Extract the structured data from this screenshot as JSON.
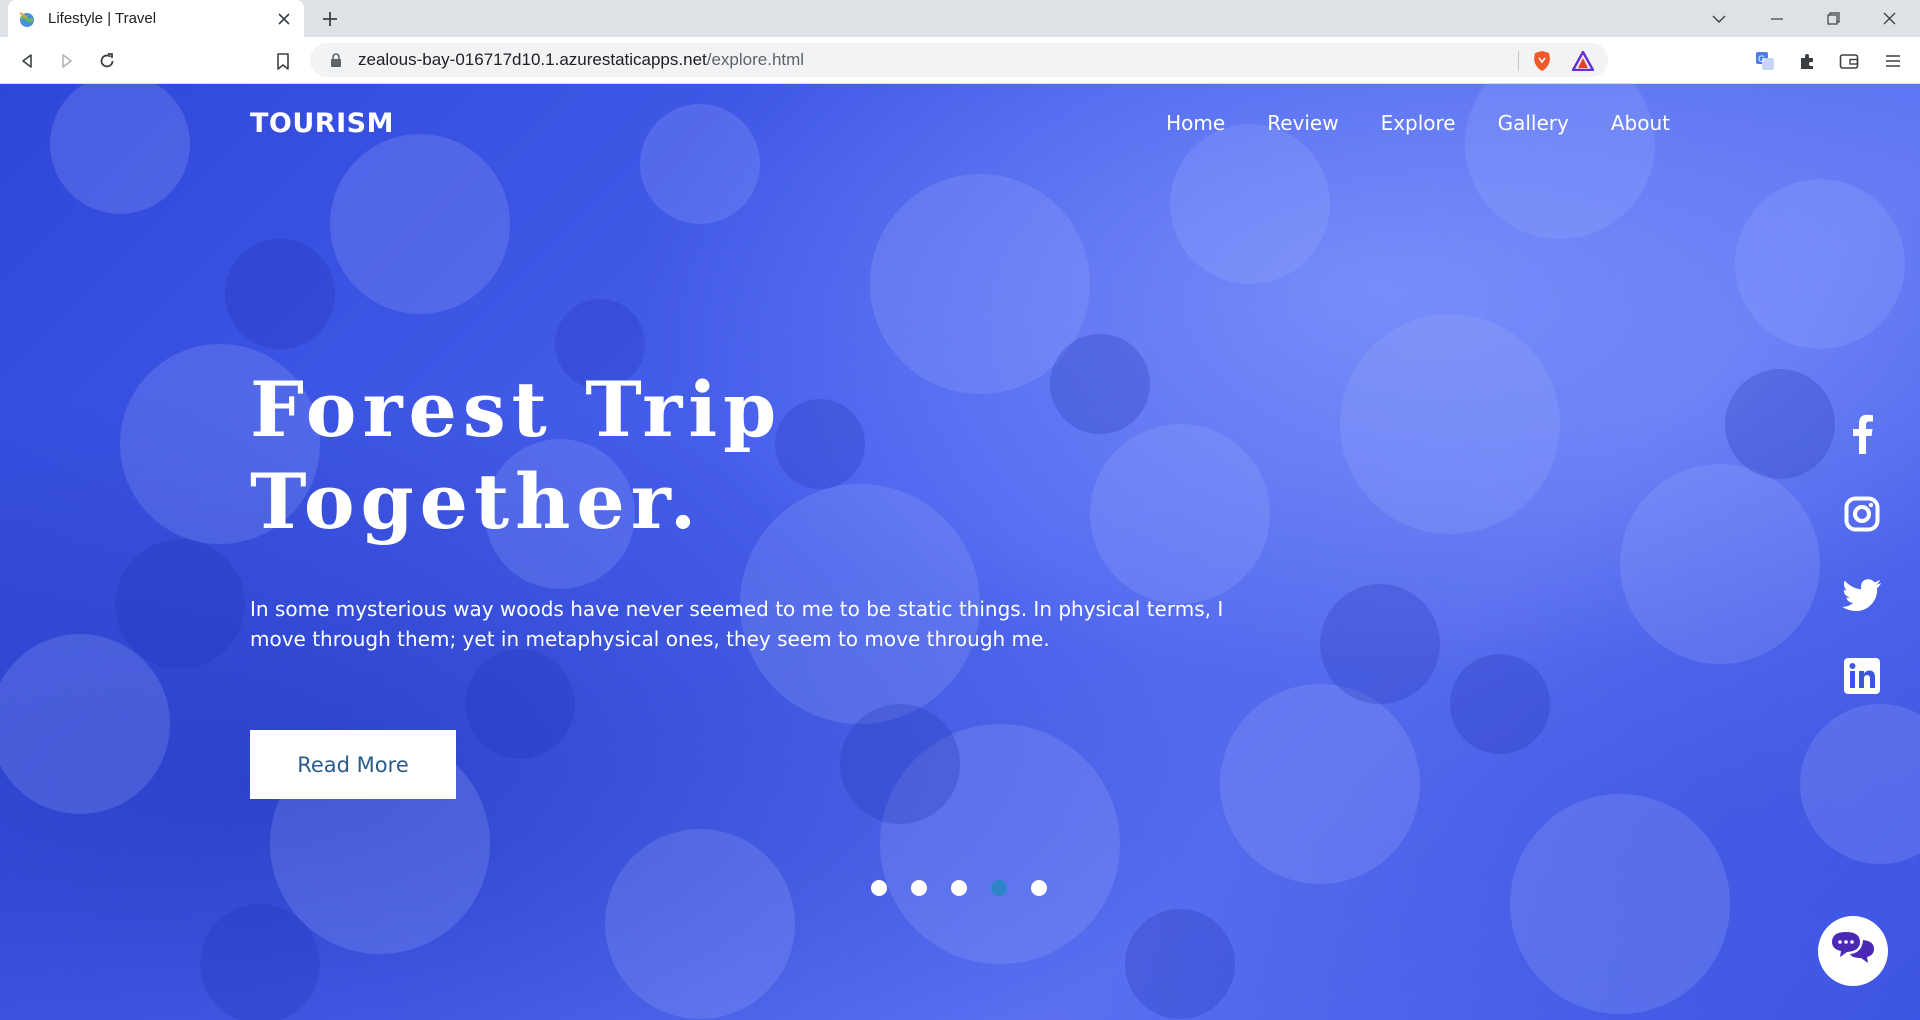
{
  "browser": {
    "tab_title": "Lifestyle | Travel",
    "url_host": "zealous-bay-016717d10.1.azurestaticapps.net",
    "url_path": "/explore.html"
  },
  "site": {
    "brand": "TOURISM",
    "nav": [
      "Home",
      "Review",
      "Explore",
      "Gallery",
      "About"
    ]
  },
  "hero": {
    "headline_line1": "Forest Trip",
    "headline_line2": "Together.",
    "lead": "In some mysterious way woods have never seemed to me to be static things. In physical terms, I move through them; yet in metaphysical ones, they seem to move through me.",
    "cta": "Read More"
  },
  "carousel": {
    "count": 5,
    "active_index": 3
  },
  "social": [
    "facebook-icon",
    "instagram-icon",
    "twitter-icon",
    "linkedin-icon"
  ],
  "colors": {
    "hero_blue": "#3a55e8",
    "button_text": "#2b5d8c",
    "active_dot": "#2e86c9",
    "chat_icon": "#4a2ab5"
  }
}
